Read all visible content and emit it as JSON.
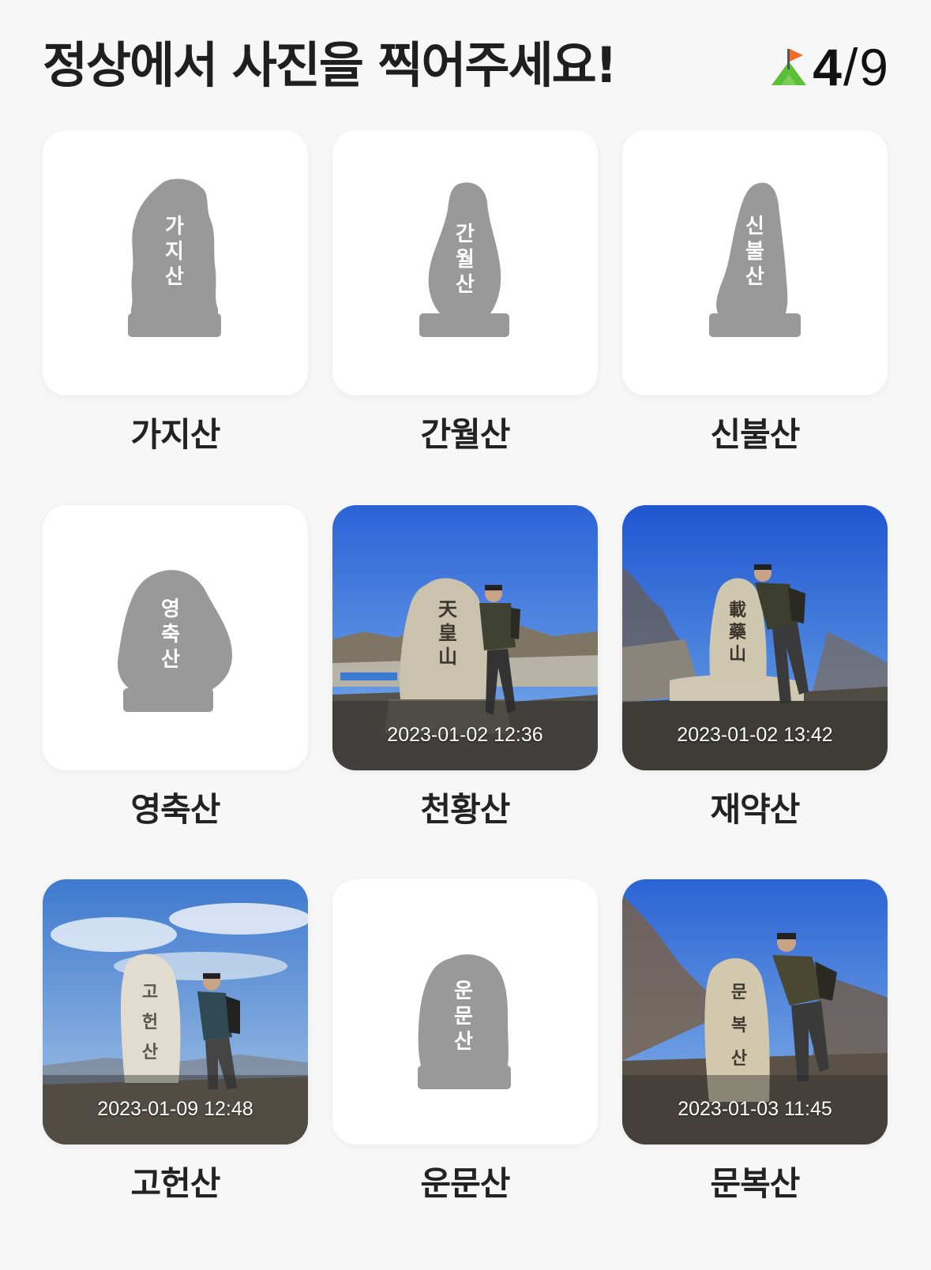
{
  "header": {
    "title": "정상에서 사진을 찍어주세요!",
    "progress_count": "4",
    "progress_separator": "/",
    "progress_total": "9",
    "icon": "mountain-flag-icon"
  },
  "mountains": [
    {
      "name": "가지산",
      "stone_text": [
        "가",
        "지",
        "산"
      ],
      "captured": false
    },
    {
      "name": "간월산",
      "stone_text": [
        "간",
        "월",
        "산"
      ],
      "captured": false
    },
    {
      "name": "신불산",
      "stone_text": [
        "신",
        "불",
        "산"
      ],
      "captured": false
    },
    {
      "name": "영축산",
      "stone_text": [
        "영",
        "축",
        "산"
      ],
      "captured": false
    },
    {
      "name": "천황산",
      "captured": true,
      "timestamp": "2023-01-02 12:36",
      "stone_text": [
        "天",
        "皇",
        "山"
      ]
    },
    {
      "name": "재약산",
      "captured": true,
      "timestamp": "2023-01-02 13:42",
      "stone_text": [
        "載",
        "藥",
        "山"
      ]
    },
    {
      "name": "고헌산",
      "captured": true,
      "timestamp": "2023-01-09 12:48",
      "stone_text": [
        "고",
        "헌",
        "산"
      ]
    },
    {
      "name": "운문산",
      "stone_text": [
        "운",
        "문",
        "산"
      ],
      "captured": false
    },
    {
      "name": "문복산",
      "captured": true,
      "timestamp": "2023-01-03 11:45",
      "stone_text": [
        "문",
        "복",
        "산"
      ]
    }
  ],
  "colors": {
    "background": "#f7f7f7",
    "placeholder_stone": "#999999",
    "flag": "#f26b2a",
    "mountain": "#5cbf3a"
  }
}
